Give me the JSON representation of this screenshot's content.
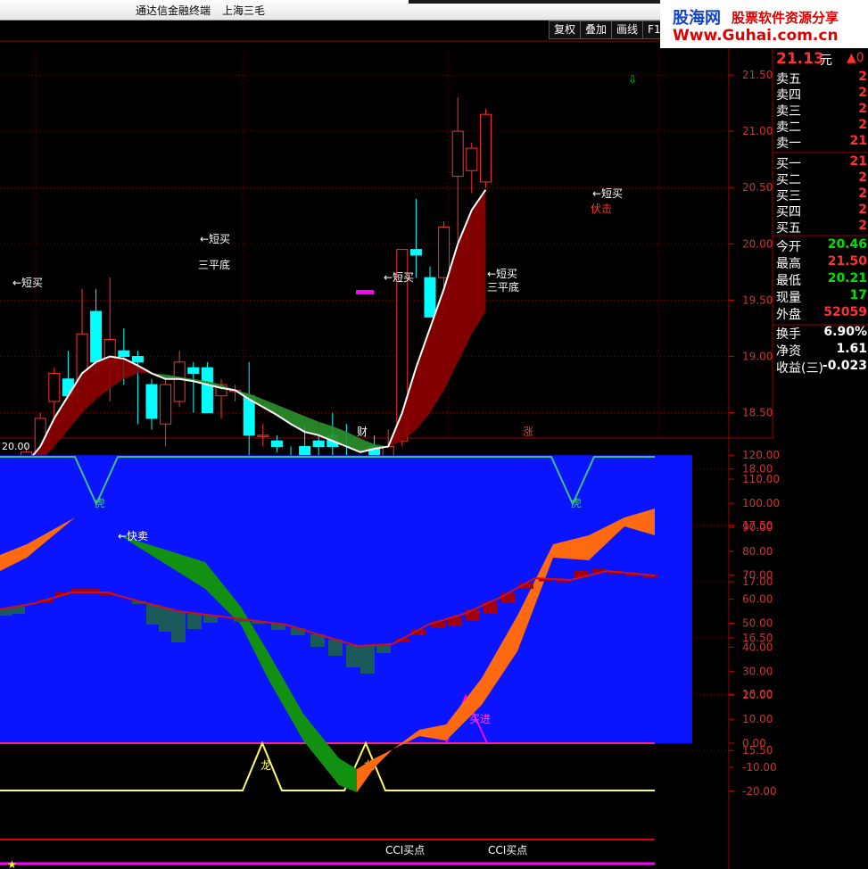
{
  "window": {
    "app_title": "通达信金融终端",
    "stock_name": "上海三毛"
  },
  "toolbar": {
    "buttons": [
      "复权",
      "叠加",
      "画线",
      "F10"
    ]
  },
  "logo": {
    "brand": "股海网",
    "tagline": "股票软件资源分享",
    "url": "Www.Guhai.com.cn"
  },
  "quote_panel": {
    "price": "21.13",
    "price_unit": "元",
    "order_book": [
      {
        "label": "卖五",
        "value": "2"
      },
      {
        "label": "卖四",
        "value": "2"
      },
      {
        "label": "卖三",
        "value": "2"
      },
      {
        "label": "卖二",
        "value": "2"
      },
      {
        "label": "卖一",
        "value": "21"
      },
      {
        "label": "买一",
        "value": "21"
      },
      {
        "label": "买二",
        "value": "2"
      },
      {
        "label": "买三",
        "value": "2"
      },
      {
        "label": "买四",
        "value": "2"
      },
      {
        "label": "买五",
        "value": "2"
      }
    ],
    "stats": [
      {
        "label": "今开",
        "value": "20.46",
        "color": "#00e000"
      },
      {
        "label": "最高",
        "value": "21.50",
        "color": "#ff3030"
      },
      {
        "label": "最低",
        "value": "20.21",
        "color": "#00e000"
      },
      {
        "label": "现量",
        "value": "17",
        "color": "#00e000"
      },
      {
        "label": "外盘",
        "value": "52059",
        "color": "#ff3030"
      },
      {
        "label": "换手",
        "value": "6.90%",
        "color": "#ffffff"
      },
      {
        "label": "净资",
        "value": "1.61",
        "color": "#ffffff"
      },
      {
        "label": "收益(三)",
        "value": "-0.023",
        "color": "#ffffff"
      }
    ]
  },
  "price_axis": [
    "21.50",
    "21.00",
    "20.50",
    "20.00",
    "19.50",
    "19.00",
    "18.50",
    "18.00",
    "17.50",
    "17.00",
    "16.50",
    "16.00",
    "15.50"
  ],
  "indicator_axis": [
    "120.00",
    "110.00",
    "100.00",
    "90.00",
    "80.00",
    "70.00",
    "60.00",
    "50.00",
    "40.00",
    "30.00",
    "20.00",
    "10.00",
    "0.00",
    "-10.00",
    "-20.00"
  ],
  "indicator_header": "20.00",
  "markers": {
    "finance": "财",
    "rise": "涨",
    "short_buy": "短买",
    "triple_bottom": "三平底",
    "ambush": "伏击",
    "quick_sell": "快卖",
    "tiger": "虎",
    "dragon": "龙",
    "buy_in": "买进",
    "cci_buy": "CCI买点",
    "star": "★"
  },
  "colors": {
    "up": "#ff3030",
    "down": "#00ffff",
    "ma_short": "#ffffff",
    "ma_long": "#ffff00",
    "grid": "#7a0000"
  }
}
